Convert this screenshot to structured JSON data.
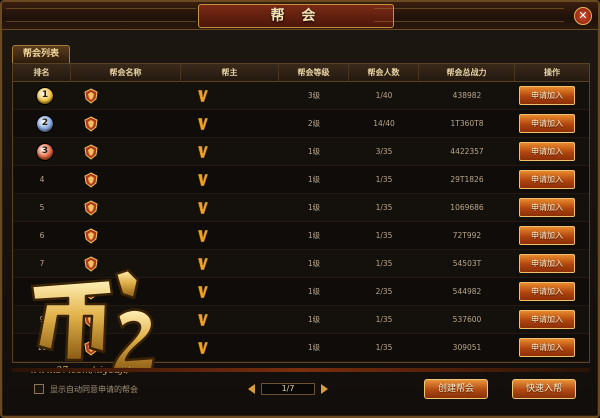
{
  "window": {
    "title": "帮 会",
    "close_label": "✕"
  },
  "tab": {
    "label": "帮会列表"
  },
  "table": {
    "headers": [
      "排名",
      "帮会名称",
      "帮主",
      "帮会等级",
      "帮会人数",
      "帮会总战力",
      "操作"
    ],
    "rows": [
      {
        "rank": "1",
        "level": "3级",
        "members": "1/40",
        "power": "438982",
        "action": "申请加入"
      },
      {
        "rank": "2",
        "level": "2级",
        "members": "14/40",
        "power": "1T360T8",
        "action": "申请加入"
      },
      {
        "rank": "3",
        "level": "1级",
        "members": "3/35",
        "power": "4422357",
        "action": "申请加入"
      },
      {
        "rank": "4",
        "level": "1级",
        "members": "1/35",
        "power": "29T1826",
        "action": "申请加入"
      },
      {
        "rank": "5",
        "level": "1级",
        "members": "1/35",
        "power": "1069686",
        "action": "申请加入"
      },
      {
        "rank": "6",
        "level": "1级",
        "members": "1/35",
        "power": "72T992",
        "action": "申请加入"
      },
      {
        "rank": "7",
        "level": "1级",
        "members": "1/35",
        "power": "54503T",
        "action": "申请加入"
      },
      {
        "rank": "8",
        "level": "1级",
        "members": "2/35",
        "power": "544982",
        "action": "申请加入"
      },
      {
        "rank": "9",
        "level": "1级",
        "members": "1/35",
        "power": "537600",
        "action": "申请加入"
      },
      {
        "rank": "10",
        "level": "1级",
        "members": "1/35",
        "power": "309051",
        "action": "申请加入"
      }
    ]
  },
  "watermark": {
    "url": "www.37.com/xiyouji/",
    "logo_text": "西游2"
  },
  "footer": {
    "auto_approve_label": "显示自动同意申请的帮会",
    "page_indicator": "1/7",
    "create_button": "创建帮会",
    "quick_join_button": "快速入帮"
  },
  "colors": {
    "gold_medal": "#f2c23a",
    "silver_medal": "#7fa6e0",
    "bronze_medal": "#e0623a",
    "button_orange": "#d9722a",
    "title_red": "#7a2a14"
  },
  "icons": {
    "guild_emblem": "guild-emblem-icon",
    "leader_v": "leader-v-icon",
    "close": "close-icon"
  }
}
